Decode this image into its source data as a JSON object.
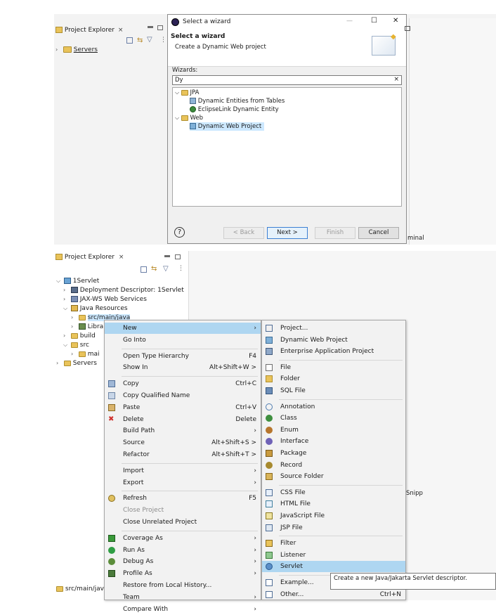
{
  "top": {
    "project_explorer": {
      "tab_label": "Project Explorer",
      "tab_close": "×",
      "tree_item": "Servers"
    },
    "dialog": {
      "title": "Select a wizard",
      "heading": "Select a wizard",
      "subheading": "Create a Dynamic Web project",
      "wizards_label": "Wizards:",
      "filter_value": "Dy",
      "clear_glyph": "×",
      "tree": [
        {
          "label": "JPA",
          "level": 0,
          "kind": "folder"
        },
        {
          "label": "Dynamic Entities from Tables",
          "level": 1,
          "kind": "item"
        },
        {
          "label": "EclipseLink Dynamic Entity",
          "level": 1,
          "kind": "item"
        },
        {
          "label": "Web",
          "level": 0,
          "kind": "folder"
        },
        {
          "label": "Dynamic Web Project",
          "level": 1,
          "kind": "item",
          "selected": true
        }
      ],
      "buttons": {
        "back": "< Back",
        "next": "Next >",
        "finish": "Finish",
        "cancel": "Cancel"
      },
      "help_glyph": "?",
      "window_controls": {
        "minimize": "—",
        "maximize": "☐",
        "close": "✕"
      }
    },
    "right_edge_text": "minal"
  },
  "bottom": {
    "project_explorer": {
      "tab_label": "Project Explorer",
      "tab_close": "×",
      "tree": [
        {
          "label": "1Servlet",
          "level": 0,
          "expanded": true
        },
        {
          "label": "Deployment Descriptor: 1Servlet",
          "level": 1,
          "expanded": false
        },
        {
          "label": "JAX-WS Web Services",
          "level": 1,
          "expanded": false
        },
        {
          "label": "Java Resources",
          "level": 1,
          "expanded": true
        },
        {
          "label": "src/main/java",
          "level": 2,
          "expanded": false
        },
        {
          "label": "Libra",
          "level": 2,
          "expanded": false
        },
        {
          "label": "build",
          "level": 1,
          "expanded": false
        },
        {
          "label": "src",
          "level": 1,
          "expanded": true
        },
        {
          "label": "mai",
          "level": 2,
          "expanded": false
        },
        {
          "label": "Servers",
          "level": 0,
          "expanded": false
        }
      ],
      "status_bar": "src/main/java"
    },
    "context_menu": [
      {
        "label": "New",
        "accel": "",
        "submenu": true,
        "highlight": true
      },
      {
        "label": "Go Into",
        "accel": ""
      },
      {
        "sep": true
      },
      {
        "label": "Open Type Hierarchy",
        "accel": "F4"
      },
      {
        "label": "Show In",
        "accel": "Alt+Shift+W >"
      },
      {
        "sep": true
      },
      {
        "label": "Copy",
        "accel": "Ctrl+C",
        "icon": "copy-icon"
      },
      {
        "label": "Copy Qualified Name",
        "accel": "",
        "icon": "copy-qualified-icon"
      },
      {
        "label": "Paste",
        "accel": "Ctrl+V",
        "icon": "paste-icon"
      },
      {
        "label": "Delete",
        "accel": "Delete",
        "icon": "delete-icon"
      },
      {
        "label": "Build Path",
        "accel": "",
        "submenu": true
      },
      {
        "label": "Source",
        "accel": "Alt+Shift+S >"
      },
      {
        "label": "Refactor",
        "accel": "Alt+Shift+T >"
      },
      {
        "sep": true
      },
      {
        "label": "Import",
        "accel": "",
        "submenu": true
      },
      {
        "label": "Export",
        "accel": "",
        "submenu": true
      },
      {
        "sep": true
      },
      {
        "label": "Refresh",
        "accel": "F5",
        "icon": "refresh-icon"
      },
      {
        "label": "Close Project",
        "accel": "",
        "disabled": true
      },
      {
        "label": "Close Unrelated Project",
        "accel": ""
      },
      {
        "sep": true
      },
      {
        "label": "Coverage As",
        "accel": "",
        "submenu": true,
        "icon": "coverage-icon"
      },
      {
        "label": "Run As",
        "accel": "",
        "submenu": true,
        "icon": "run-icon"
      },
      {
        "label": "Debug As",
        "accel": "",
        "submenu": true,
        "icon": "debug-icon"
      },
      {
        "label": "Profile As",
        "accel": "",
        "submenu": true,
        "icon": "profile-icon"
      },
      {
        "label": "Restore from Local History...",
        "accel": ""
      },
      {
        "label": "Team",
        "accel": "",
        "submenu": true
      },
      {
        "label": "Compare With",
        "accel": "",
        "submenu": true
      }
    ],
    "new_submenu": [
      {
        "label": "Project...",
        "icon": "project-icon"
      },
      {
        "label": "Dynamic Web Project",
        "icon": "web-project-icon"
      },
      {
        "label": "Enterprise Application Project",
        "icon": "ear-project-icon"
      },
      {
        "sep": true
      },
      {
        "label": "File",
        "icon": "file-icon"
      },
      {
        "label": "Folder",
        "icon": "folder-icon"
      },
      {
        "label": "SQL File",
        "icon": "sql-file-icon"
      },
      {
        "sep": true
      },
      {
        "label": "Annotation",
        "icon": "annotation-icon"
      },
      {
        "label": "Class",
        "icon": "class-icon"
      },
      {
        "label": "Enum",
        "icon": "enum-icon"
      },
      {
        "label": "Interface",
        "icon": "interface-icon"
      },
      {
        "label": "Package",
        "icon": "package-icon"
      },
      {
        "label": "Record",
        "icon": "record-icon"
      },
      {
        "label": "Source Folder",
        "icon": "source-folder-icon"
      },
      {
        "sep": true
      },
      {
        "label": "CSS File",
        "icon": "css-file-icon"
      },
      {
        "label": "HTML File",
        "icon": "html-file-icon"
      },
      {
        "label": "JavaScript File",
        "icon": "js-file-icon"
      },
      {
        "label": "JSP File",
        "icon": "jsp-file-icon"
      },
      {
        "sep": true
      },
      {
        "label": "Filter",
        "icon": "filter-icon"
      },
      {
        "label": "Listener",
        "icon": "listener-icon"
      },
      {
        "label": "Servlet",
        "icon": "servlet-icon",
        "highlight": true
      },
      {
        "sep": true
      },
      {
        "label": "Example...",
        "icon": "example-icon"
      },
      {
        "label": "Other...",
        "accel": "Ctrl+N",
        "icon": "other-icon"
      }
    ],
    "tooltip": "Create a new Java/Jakarta Servlet descriptor.",
    "right_pane_text": "Snipp"
  }
}
